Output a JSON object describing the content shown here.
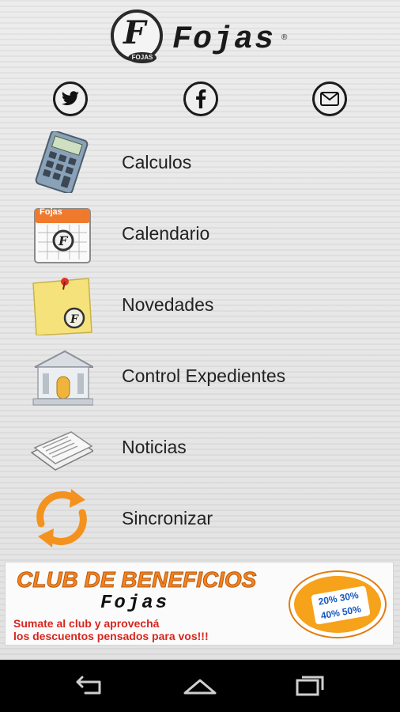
{
  "header": {
    "logo_letter": "F",
    "logo_small": "FOJAS",
    "brand": "Fojas",
    "registered": "®"
  },
  "social": [
    {
      "name": "twitter",
      "icon": "twitter-icon"
    },
    {
      "name": "facebook",
      "icon": "facebook-icon"
    },
    {
      "name": "email",
      "icon": "mail-icon"
    }
  ],
  "menu": [
    {
      "label": "Calculos",
      "icon": "calculator-icon"
    },
    {
      "label": "Calendario",
      "icon": "calendar-icon"
    },
    {
      "label": "Novedades",
      "icon": "sticky-note-icon"
    },
    {
      "label": "Control Expedientes",
      "icon": "courthouse-icon"
    },
    {
      "label": "Noticias",
      "icon": "newspaper-icon"
    },
    {
      "label": "Sincronizar",
      "icon": "sync-icon"
    }
  ],
  "calendar_header": "Fojas",
  "banner": {
    "title": "CLUB DE BENEFICIOS",
    "brand": "Fojas",
    "line1": "Sumate al club y aprovechá",
    "line2": "los descuentos pensados para vos!!!",
    "tag_line1": "20% 30%",
    "tag_line2": "40% 50%"
  },
  "colors": {
    "accent_orange": "#f58220",
    "banner_text_red": "#d7261e",
    "navbar": "#000000"
  },
  "navbar": [
    {
      "icon": "back-icon"
    },
    {
      "icon": "home-icon"
    },
    {
      "icon": "recent-apps-icon"
    }
  ]
}
